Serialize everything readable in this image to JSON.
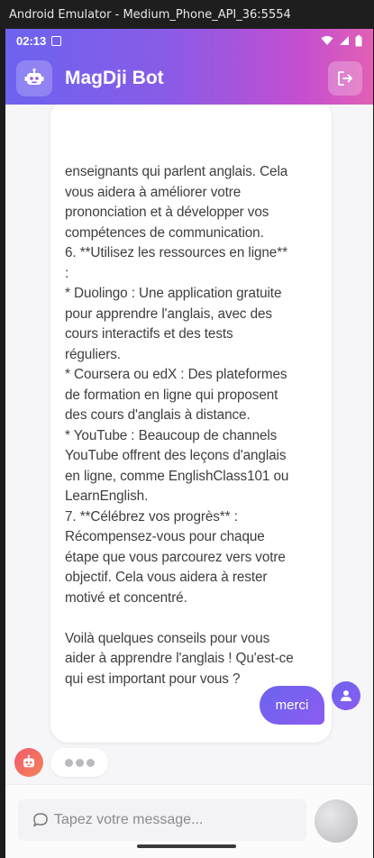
{
  "window": {
    "title": "Android Emulator - Medium_Phone_API_36:5554"
  },
  "status_bar": {
    "time": "02:13"
  },
  "app_bar": {
    "title": "MagDji Bot",
    "bot_icon": "robot-icon",
    "logout_icon": "logout-icon"
  },
  "messages": {
    "bot_text": "enseignants qui parlent anglais. Cela\nvous aidera à améliorer votre\nprononciation et à développer vos\ncompétences de communication.\n6. **Utilisez les ressources en ligne**\n:\n* Duolingo : Une application gratuite\npour apprendre l'anglais, avec des\ncours interactifs et des tests\nréguliers.\n* Coursera ou edX : Des plateformes\nde formation en ligne qui proposent\ndes cours d'anglais à distance.\n* YouTube : Beaucoup de channels\nYouTube offrent des leçons d'anglais\nen ligne, comme EnglishClass101 ou\nLearnEnglish.\n7. **Célébrez vos progrès** :\nRécompensez-vous pour chaque\nétape que vous parcourez vers votre\nobjectif. Cela vous aidera à rester\nmotivé et concentré.\n\nVoilà quelques conseils pour vous\naider à apprendre l'anglais ! Qu'est-ce\nqui est important pour vous ?",
    "user_text": "merci"
  },
  "input": {
    "placeholder": "Tapez votre message...",
    "value": ""
  },
  "colors": {
    "gradient_start": "#6c63f0",
    "gradient_end": "#e25fb5",
    "user_bubble": "#7b5ff0",
    "bot_avatar": "#f2705e"
  }
}
